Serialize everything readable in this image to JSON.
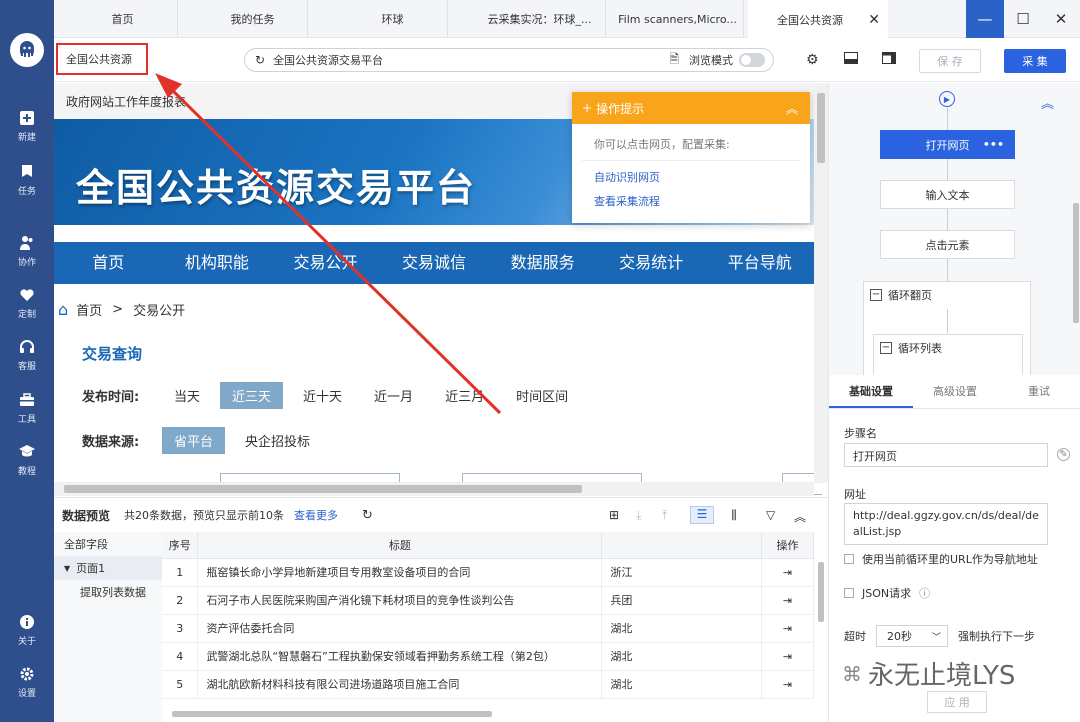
{
  "sidebar": {
    "items": [
      {
        "label": "新建",
        "icon": "plus-square-icon"
      },
      {
        "label": "任务",
        "icon": "flag-icon"
      },
      {
        "label": "协作",
        "icon": "users-icon"
      },
      {
        "label": "定制",
        "icon": "heart-icon"
      },
      {
        "label": "客服",
        "icon": "headset-icon"
      },
      {
        "label": "工具",
        "icon": "toolbox-icon"
      },
      {
        "label": "教程",
        "icon": "graduation-cap-icon"
      },
      {
        "label": "关于",
        "icon": "info-icon"
      },
      {
        "label": "设置",
        "icon": "gear-icon"
      }
    ]
  },
  "tabs": [
    {
      "label": "首页"
    },
    {
      "label": "我的任务"
    },
    {
      "label": "环球"
    },
    {
      "label": "云采集实况：环球_..."
    },
    {
      "label": "Film scanners,Micro..."
    },
    {
      "label": "全国公共资源"
    }
  ],
  "toolbar": {
    "crumb": "全国公共资源",
    "url_text": "全国公共资源交易平台",
    "browse_mode": "浏览模式",
    "save_label": "保 存",
    "collect_label": "采 集"
  },
  "web": {
    "top_text": "政府网站工作年度报表",
    "banner_title": "全国公共资源交易平台",
    "nav": [
      "首页",
      "机构职能",
      "交易公开",
      "交易诚信",
      "数据服务",
      "交易统计",
      "平台导航"
    ],
    "crumb_home": "首页",
    "crumb_sep": ">",
    "crumb_current": "交易公开",
    "query_title": "交易查询",
    "publish_time_label": "发布时间:",
    "publish_time_options": [
      "当天",
      "近三天",
      "近十天",
      "近一月",
      "近三月",
      "时间区间"
    ],
    "publish_time_selected": "近三天",
    "source_label": "数据来源:",
    "source_options": [
      "省平台",
      "央企招投标"
    ],
    "source_selected": "省平台"
  },
  "popup": {
    "title": "操作提示",
    "tip": "你可以点击网页，配置采集:",
    "links": [
      "自动识别网页",
      "查看采集流程"
    ]
  },
  "preview": {
    "title": "数据预览",
    "count_text": "共20条数据，预览只显示前10条",
    "more_link": "查看更多",
    "fields": [
      "全部字段",
      "页面1",
      "提取列表数据"
    ],
    "columns": [
      "序号",
      "标题",
      "",
      "操作"
    ],
    "rows": [
      {
        "idx": "1",
        "title": "瓶窑镇长命小学异地新建项目专用教室设备项目的合同",
        "region": "浙江"
      },
      {
        "idx": "2",
        "title": "石河子市人民医院采购国产消化镜下耗材项目的竞争性谈判公告",
        "region": "兵团"
      },
      {
        "idx": "3",
        "title": "资产评估委托合同",
        "region": "湖北"
      },
      {
        "idx": "4",
        "title": "武警湖北总队“智慧磐石”工程执勤保安领域看押勤务系统工程（第2包）",
        "region": "湖北"
      },
      {
        "idx": "5",
        "title": "湖北航欧新材料科技有限公司进场道路项目施工合同",
        "region": "湖北"
      }
    ]
  },
  "flow": {
    "nodes": [
      "打开网页",
      "输入文本",
      "点击元素"
    ],
    "loops": [
      "循环翻页",
      "循环列表"
    ]
  },
  "settings": {
    "tabs": [
      "基础设置",
      "高级设置",
      "重试"
    ],
    "active_tab": "基础设置",
    "step_name_label": "步骤名",
    "step_name_value": "打开网页",
    "url_label": "网址",
    "url_value": "http://deal.ggzy.gov.cn/ds/deal/dealList.jsp",
    "use_loop_url": "使用当前循环里的URL作为导航地址",
    "json_request": "JSON请求",
    "timeout_label": "超时",
    "timeout_value": "20秒",
    "force_next": "强制执行下一步",
    "apply_label": "应 用"
  },
  "watermark": "永无止境LYS",
  "colors": {
    "sidebar": "#2e4e8c",
    "accent": "#2b62e0",
    "popup_header": "#f9a51b",
    "highlight_red": "#e0322b",
    "web_nav": "#1a67b5"
  }
}
